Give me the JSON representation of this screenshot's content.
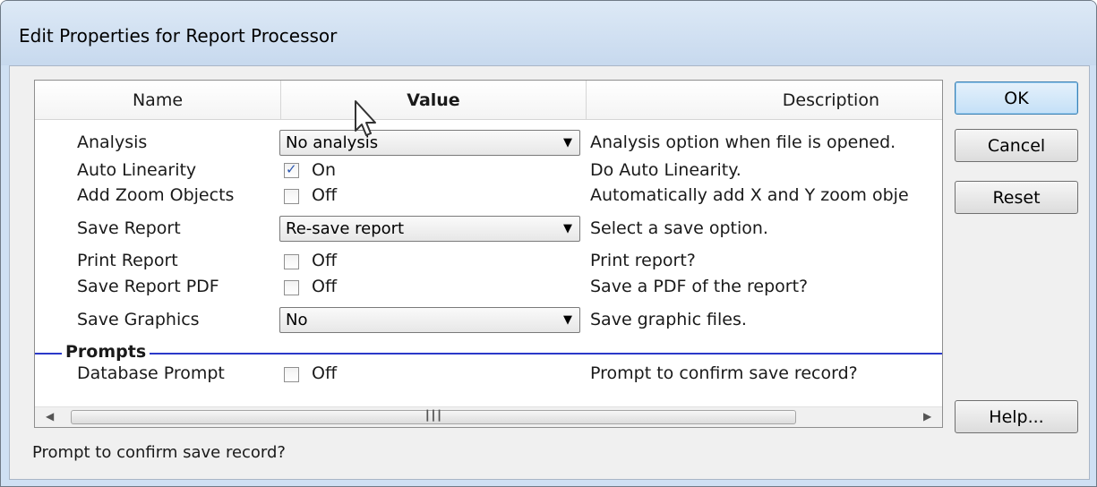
{
  "window": {
    "title": "Edit Properties for Report Processor"
  },
  "grid": {
    "columns": [
      "Name",
      "Value",
      "Description"
    ],
    "rows": [
      {
        "name": "Analysis",
        "type": "select",
        "value": "No analysis",
        "description": "Analysis option when file is opened."
      },
      {
        "name": "Auto Linearity",
        "type": "checkbox",
        "checked": true,
        "value": "On",
        "description": "Do Auto Linearity."
      },
      {
        "name": "Add Zoom Objects",
        "type": "checkbox",
        "checked": false,
        "value": "Off",
        "description": "Automatically add X and Y zoom obje"
      },
      {
        "name": "Save Report",
        "type": "select",
        "value": "Re-save report",
        "description": "Select a save option."
      },
      {
        "name": "Print Report",
        "type": "checkbox",
        "checked": false,
        "value": "Off",
        "description": "Print report?"
      },
      {
        "name": "Save Report PDF",
        "type": "checkbox",
        "checked": false,
        "value": "Off",
        "description": "Save a PDF of the report?"
      },
      {
        "name": "Save Graphics",
        "type": "select",
        "value": "No",
        "description": "Save graphic files."
      }
    ],
    "group": {
      "label": "Prompts",
      "rows": [
        {
          "name": "Database Prompt",
          "type": "checkbox",
          "checked": false,
          "value": "Off",
          "description": "Prompt to confirm save record?"
        }
      ]
    },
    "scrollbar": {
      "left_icon": "scroll-left-arrow-icon",
      "right_icon": "scroll-right-arrow-icon",
      "grip_icon": "scroll-grip-icon"
    }
  },
  "buttons": {
    "ok": "OK",
    "cancel": "Cancel",
    "reset": "Reset",
    "help": "Help..."
  },
  "status_text": "Prompt to confirm save record?",
  "colors": {
    "group_line": "#2b39c9",
    "checkmark": "#2a56b0",
    "default_button": "#c4e0f7",
    "title_bar": "#cfe0f3"
  }
}
